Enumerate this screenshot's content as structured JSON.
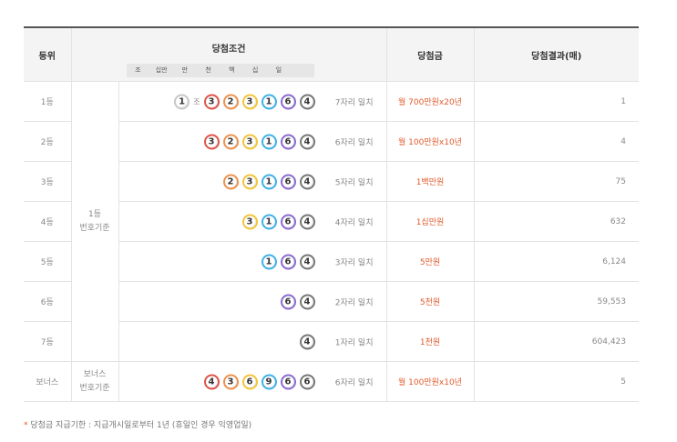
{
  "header": {
    "rank": "등위",
    "condition": "당첨조건",
    "prize": "당첨금",
    "result": "당첨결과(매)",
    "digits": [
      "조",
      "십만",
      "만",
      "천",
      "백",
      "십",
      "일"
    ]
  },
  "ball_colors": {
    "red": "#e2544a",
    "orange": "#f0914a",
    "yellow": "#f3c53a",
    "blue": "#3fb3e5",
    "purple": "#8b6ad0",
    "gray": "#777777",
    "lightgray": "#c8c8c8"
  },
  "rows": [
    {
      "rank": "1등",
      "basis": "",
      "jo": {
        "digit": "1",
        "color": "lightgray",
        "label": "조"
      },
      "balls": [
        {
          "d": "3",
          "c": "red"
        },
        {
          "d": "2",
          "c": "orange"
        },
        {
          "d": "3",
          "c": "yellow"
        },
        {
          "d": "1",
          "c": "blue"
        },
        {
          "d": "6",
          "c": "purple"
        },
        {
          "d": "4",
          "c": "gray"
        }
      ],
      "match": "7자리 일치",
      "prize": "월 700만원x20년",
      "result": "1"
    },
    {
      "rank": "2등",
      "basis": "",
      "balls": [
        {
          "d": "3",
          "c": "red"
        },
        {
          "d": "2",
          "c": "orange"
        },
        {
          "d": "3",
          "c": "yellow"
        },
        {
          "d": "1",
          "c": "blue"
        },
        {
          "d": "6",
          "c": "purple"
        },
        {
          "d": "4",
          "c": "gray"
        }
      ],
      "match": "6자리 일치",
      "prize": "월 100만원x10년",
      "result": "4"
    },
    {
      "rank": "3등",
      "basis": "",
      "balls": [
        {
          "d": "2",
          "c": "orange"
        },
        {
          "d": "3",
          "c": "yellow"
        },
        {
          "d": "1",
          "c": "blue"
        },
        {
          "d": "6",
          "c": "purple"
        },
        {
          "d": "4",
          "c": "gray"
        }
      ],
      "match": "5자리 일치",
      "prize": "1백만원",
      "result": "75"
    },
    {
      "rank": "4등",
      "basis": "",
      "balls": [
        {
          "d": "3",
          "c": "yellow"
        },
        {
          "d": "1",
          "c": "blue"
        },
        {
          "d": "6",
          "c": "purple"
        },
        {
          "d": "4",
          "c": "gray"
        }
      ],
      "match": "4자리 일치",
      "prize": "1십만원",
      "result": "632"
    },
    {
      "rank": "5등",
      "basis": "",
      "balls": [
        {
          "d": "1",
          "c": "blue"
        },
        {
          "d": "6",
          "c": "purple"
        },
        {
          "d": "4",
          "c": "gray"
        }
      ],
      "match": "3자리 일치",
      "prize": "5만원",
      "result": "6,124"
    },
    {
      "rank": "6등",
      "basis": "",
      "balls": [
        {
          "d": "6",
          "c": "purple"
        },
        {
          "d": "4",
          "c": "gray"
        }
      ],
      "match": "2자리 일치",
      "prize": "5천원",
      "result": "59,553"
    },
    {
      "rank": "7등",
      "basis": "",
      "balls": [
        {
          "d": "4",
          "c": "gray"
        }
      ],
      "match": "1자리 일치",
      "prize": "1천원",
      "result": "604,423"
    },
    {
      "rank": "보너스",
      "basis": "",
      "balls": [
        {
          "d": "4",
          "c": "red"
        },
        {
          "d": "3",
          "c": "orange"
        },
        {
          "d": "6",
          "c": "yellow"
        },
        {
          "d": "9",
          "c": "blue"
        },
        {
          "d": "6",
          "c": "purple"
        },
        {
          "d": "6",
          "c": "gray"
        }
      ],
      "match": "6자리 일치",
      "prize": "월 100만원x10년",
      "result": "5"
    }
  ],
  "basis_main": [
    "1등",
    "번호기준"
  ],
  "basis_bonus": [
    "보너스",
    "번호기준"
  ],
  "footnote": {
    "star": "*",
    "text": " 당첨금 지급기한 : 지급개시일로부터 1년 (휴일인 경우 익영업일)"
  }
}
